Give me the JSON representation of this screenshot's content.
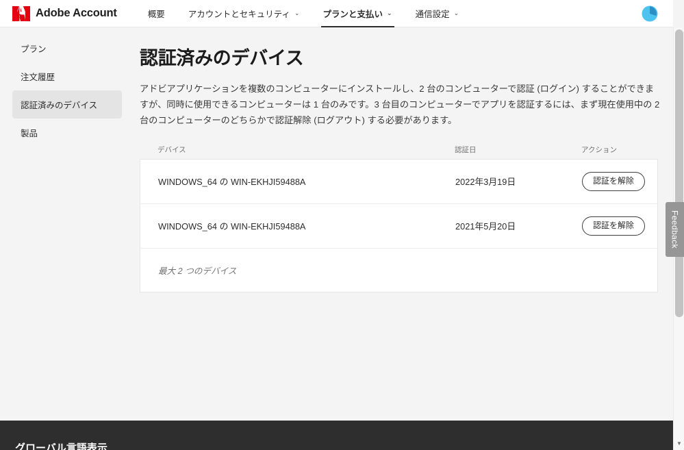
{
  "header": {
    "logo_icon": "adobe-logo-icon",
    "brand": "Adobe Account",
    "nav": [
      {
        "label": "概要",
        "has_caret": false,
        "active": false
      },
      {
        "label": "アカウントとセキュリティ",
        "has_caret": true,
        "active": false
      },
      {
        "label": "プランと支払い",
        "has_caret": true,
        "active": true
      },
      {
        "label": "通信設定",
        "has_caret": true,
        "active": false
      }
    ],
    "caret_glyph": "⌄",
    "avatar_icon": "user-avatar",
    "avatar_color": "#4dc3f0",
    "avatar_wedge_color": "#2d8fc4"
  },
  "sidebar": {
    "items": [
      {
        "label": "プラン",
        "active": false
      },
      {
        "label": "注文履歴",
        "active": false
      },
      {
        "label": "認証済みのデバイス",
        "active": true
      },
      {
        "label": "製品",
        "active": false
      }
    ]
  },
  "main": {
    "title": "認証済みのデバイス",
    "description": "アドビアプリケーションを複数のコンピューターにインストールし、2 台のコンピューターで認証 (ログイン) することができますが、同時に使用できるコンピューターは 1 台のみです。3 台目のコンピューターでアプリを認証するには、まず現在使用中の 2 台のコンピューターのどちらかで認証解除 (ログアウト) する必要があります。",
    "table": {
      "columns": {
        "device": "デバイス",
        "date": "認証日",
        "action": "アクション"
      },
      "rows": [
        {
          "device": "WINDOWS_64 の WIN-EKHJI59488A",
          "date": "2022年3月19日",
          "action_label": "認証を解除"
        },
        {
          "device": "WINDOWS_64 の WIN-EKHJI59488A",
          "date": "2021年5月20日",
          "action_label": "認証を解除"
        }
      ],
      "note": "最大 2 つのデバイス"
    }
  },
  "feedback": {
    "label": "Feedback",
    "color": "#969696"
  },
  "scrollbar": {
    "arrow_glyph": "▼"
  },
  "footer": {
    "title": "グローバル言語表示",
    "background": "#2e2e2e"
  }
}
